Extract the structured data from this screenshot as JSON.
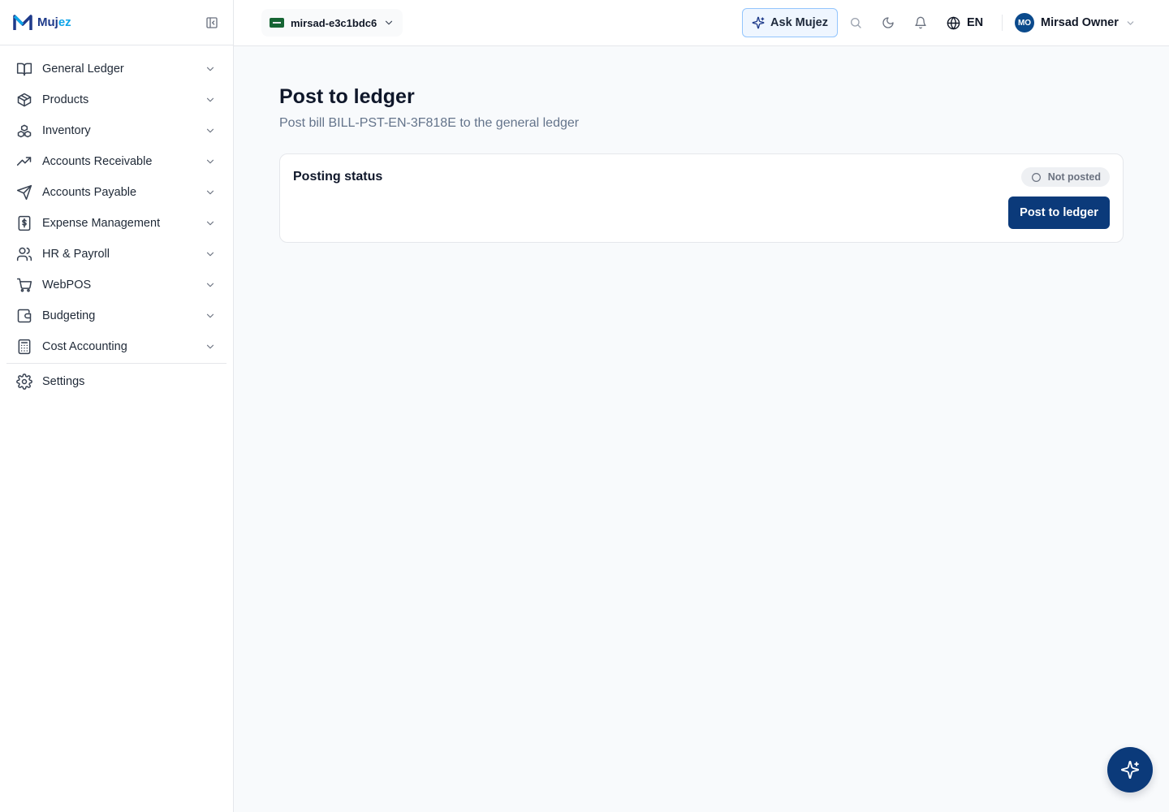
{
  "app": {
    "logo_text_main": "Muj",
    "logo_text_accent": "ez",
    "brand_color": "#1e3a8a",
    "accent_color": "#0ea5e9"
  },
  "sidebar": {
    "items": [
      {
        "label": "General Ledger",
        "icon": "book-open-icon"
      },
      {
        "label": "Products",
        "icon": "package-icon"
      },
      {
        "label": "Inventory",
        "icon": "boxes-icon"
      },
      {
        "label": "Accounts Receivable",
        "icon": "trending-up-icon"
      },
      {
        "label": "Accounts Payable",
        "icon": "send-icon"
      },
      {
        "label": "Expense Management",
        "icon": "receipt-dollar-icon"
      },
      {
        "label": "HR & Payroll",
        "icon": "users-icon"
      },
      {
        "label": "WebPOS",
        "icon": "shopping-cart-icon"
      },
      {
        "label": "Budgeting",
        "icon": "wallet-icon"
      },
      {
        "label": "Cost Accounting",
        "icon": "calculator-icon"
      }
    ],
    "settings_label": "Settings"
  },
  "topbar": {
    "tenant": "mirsad-e3c1bdc6",
    "ask_label": "Ask Mujez",
    "language": "EN",
    "user_initials": "MO",
    "user_name": "Mirsad Owner"
  },
  "page": {
    "title": "Post to ledger",
    "subtitle": "Post bill BILL-PST-EN-3F818E to the general ledger"
  },
  "card": {
    "title": "Posting status",
    "status": "Not posted",
    "action_label": "Post to ledger",
    "action_color": "#0b3a7a"
  }
}
